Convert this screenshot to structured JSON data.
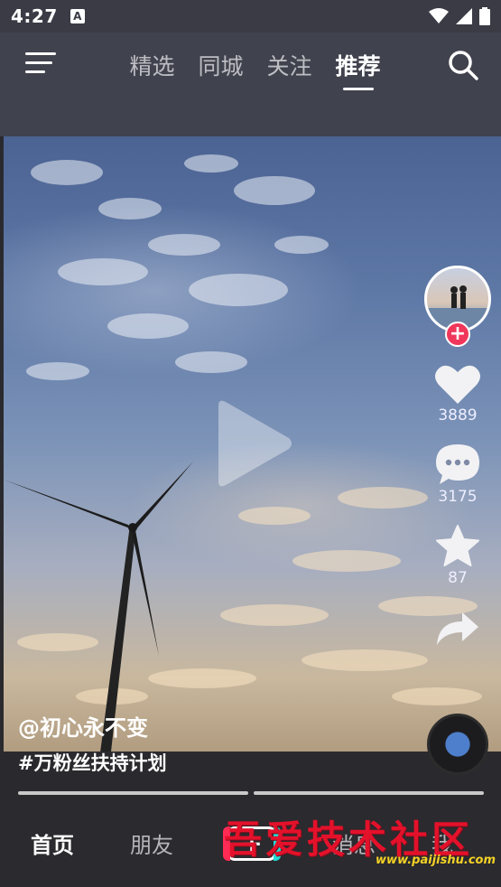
{
  "status_bar": {
    "time": "4:27",
    "notification_letter": "A"
  },
  "top_nav": {
    "tabs": [
      {
        "label": "精选",
        "active": false
      },
      {
        "label": "同城",
        "active": false
      },
      {
        "label": "关注",
        "active": false
      },
      {
        "label": "推荐",
        "active": true
      }
    ]
  },
  "video": {
    "author": "@初心永不变",
    "topic": "#万粉丝扶持计划",
    "likes": "3889",
    "comments": "3175",
    "favorites": "87",
    "follow_symbol": "+"
  },
  "bottom_nav": {
    "items": [
      "首页",
      "朋友",
      "消息",
      "我"
    ],
    "create_symbol": "+"
  },
  "watermark": {
    "title": "吾爱技术社区",
    "url": "www.paijishu.com"
  },
  "colors": {
    "accent_pink": "#f0365b",
    "accent_cyan": "#21dcd6",
    "watermark_red": "#e4112b",
    "watermark_yellow": "#f4d226"
  }
}
